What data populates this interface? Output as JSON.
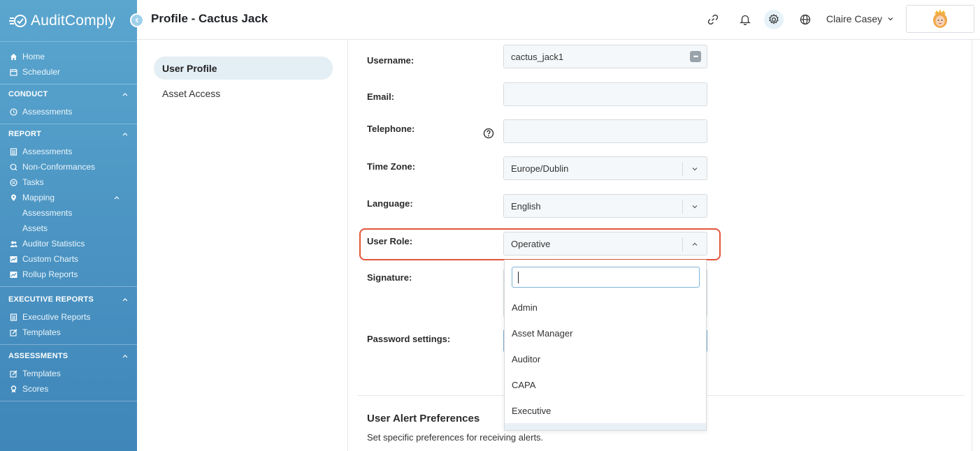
{
  "app": {
    "name": "AuditComply"
  },
  "header": {
    "title": "Profile - Cactus Jack",
    "user_name": "Claire Casey"
  },
  "sidebar": {
    "top_items": [
      {
        "label": "Home",
        "icon": "home-icon"
      },
      {
        "label": "Scheduler",
        "icon": "calendar-icon"
      }
    ],
    "sections": {
      "conduct": {
        "title": "CONDUCT",
        "items": [
          "Assessments"
        ]
      },
      "report": {
        "title": "REPORT",
        "items": [
          "Assessments",
          "Non-Conformances",
          "Tasks",
          "Mapping",
          "Auditor Statistics",
          "Custom Charts",
          "Rollup Reports"
        ],
        "mapping_sub": [
          "Assessments",
          "Assets"
        ]
      },
      "executive_reports": {
        "title": "EXECUTIVE REPORTS",
        "items": [
          "Executive Reports",
          "Templates"
        ]
      },
      "assessments": {
        "title": "ASSESSMENTS",
        "items": [
          "Templates",
          "Scores"
        ]
      }
    }
  },
  "tabs": [
    {
      "label": "User Profile",
      "active": true
    },
    {
      "label": "Asset Access",
      "active": false
    }
  ],
  "form": {
    "username": {
      "label": "Username:",
      "value": "cactus_jack1"
    },
    "email": {
      "label": "Email:",
      "value": ""
    },
    "telephone": {
      "label": "Telephone:",
      "value": ""
    },
    "time_zone": {
      "label": "Time Zone:",
      "value": "Europe/Dublin"
    },
    "language": {
      "label": "Language:",
      "value": "English"
    },
    "user_role": {
      "label": "User Role:",
      "value": "Operative"
    },
    "signature": {
      "label": "Signature:"
    },
    "password": {
      "label": "Password settings:"
    }
  },
  "role_dropdown": {
    "search_value": "",
    "options": [
      "Admin",
      "Asset Manager",
      "Auditor",
      "CAPA",
      "Executive"
    ]
  },
  "alerts": {
    "title": "User Alert Preferences",
    "subtitle": "Set specific preferences for receiving alerts."
  },
  "colors": {
    "sidebar_top": "#5aa6cf",
    "sidebar_bottom": "#3f86b9",
    "highlight_border": "#e2553a",
    "active_tab_bg": "#e3eef5"
  }
}
